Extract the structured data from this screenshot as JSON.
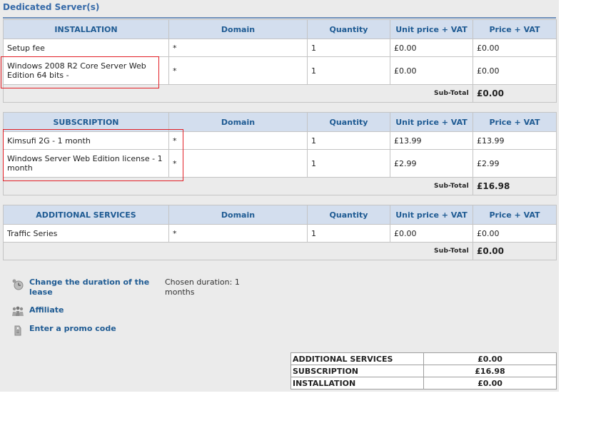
{
  "page": {
    "title": "Dedicated Server(s)"
  },
  "headers": {
    "domain": "Domain",
    "quantity": "Quantity",
    "unit_price": "Unit price + VAT",
    "price": "Price + VAT",
    "subtotal_label": "Sub-Total"
  },
  "installation": {
    "section": "INSTALLATION",
    "rows": [
      {
        "item": "Setup fee",
        "domain": "*",
        "quantity": "1",
        "unit_price": "£0.00",
        "price": "£0.00"
      },
      {
        "item": "Windows 2008 R2 Core Server Web Edition 64 bits -",
        "domain": "*",
        "quantity": "1",
        "unit_price": "£0.00",
        "price": "£0.00"
      }
    ],
    "subtotal": "£0.00"
  },
  "subscription": {
    "section": "SUBSCRIPTION",
    "rows": [
      {
        "item": "Kimsufi 2G - 1 month",
        "domain": "*",
        "quantity": "1",
        "unit_price": "£13.99",
        "price": "£13.99"
      },
      {
        "item": "Windows Server Web Edition license - 1 month",
        "domain": "*",
        "quantity": "1",
        "unit_price": "£2.99",
        "price": "£2.99"
      }
    ],
    "subtotal": "£16.98"
  },
  "additional": {
    "section": "ADDITIONAL SERVICES",
    "rows": [
      {
        "item": "Traffic Series",
        "domain": "*",
        "quantity": "1",
        "unit_price": "£0.00",
        "price": "£0.00"
      }
    ],
    "subtotal": "£0.00"
  },
  "actions": {
    "change_duration": "Change the duration of the lease",
    "chosen_duration": "Chosen duration: 1 months",
    "affiliate": "Affiliate",
    "promo": "Enter a promo code"
  },
  "summary": {
    "rows": [
      {
        "label": "ADDITIONAL SERVICES",
        "amount": "£0.00"
      },
      {
        "label": "SUBSCRIPTION",
        "amount": "£16.98"
      },
      {
        "label": "INSTALLATION",
        "amount": "£0.00"
      }
    ]
  },
  "icons": {
    "duration": "clock-icon",
    "affiliate": "people-icon",
    "promo": "coupon-icon"
  },
  "colors": {
    "header_bg": "#d3deee",
    "header_text": "#1f5b93",
    "highlight_box": "#e21f26",
    "panel_bg": "#ebebeb"
  }
}
